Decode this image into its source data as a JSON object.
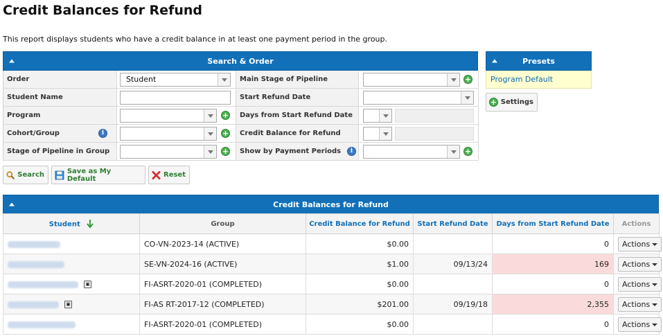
{
  "page": {
    "title": "Credit Balances for Refund",
    "description": "This report displays students who have a credit balance in at least one payment period in the group."
  },
  "search_panel": {
    "title": "Search & Order",
    "fields": {
      "order_label": "Order",
      "order_value": "Student",
      "student_name_label": "Student Name",
      "program_label": "Program",
      "cohort_label": "Cohort/Group",
      "stage_group_label": "Stage of Pipeline in Group",
      "main_stage_label": "Main Stage of Pipeline",
      "start_refund_label": "Start Refund Date",
      "days_from_label": "Days from Start Refund Date",
      "credit_balance_label": "Credit Balance for Refund",
      "show_periods_label": "Show by Payment Periods"
    },
    "buttons": {
      "search": "Search",
      "save_default": "Save as My Default",
      "reset": "Reset"
    }
  },
  "presets_panel": {
    "title": "Presets",
    "item": "Program Default",
    "settings_label": "Settings"
  },
  "results": {
    "title": "Credit Balances for Refund",
    "columns": [
      "Student",
      "Group",
      "Credit Balance for Refund",
      "Start Refund Date",
      "Days from Start Refund Date",
      "Actions"
    ],
    "rows": [
      {
        "group": "CO-VN-2023-14 (ACTIVE)",
        "balance": "$0.00",
        "start": "",
        "days": "0",
        "action": "Actions"
      },
      {
        "group": "SE-VN-2024-16 (ACTIVE)",
        "balance": "$1.00",
        "start": "09/13/24",
        "days": "169",
        "action": "Actions"
      },
      {
        "group": "FI-ASRT-2020-01 (COMPLETED)",
        "balance": "$0.00",
        "start": "",
        "days": "0",
        "action": "Actions"
      },
      {
        "group": "FI-AS RT-2017-12 (COMPLETED)",
        "balance": "$201.00",
        "start": "09/19/18",
        "days": "2,355",
        "action": "Actions"
      },
      {
        "group": "FI-ASRT-2020-01 (COMPLETED)",
        "balance": "$0.00",
        "start": "",
        "days": "0",
        "action": "Actions"
      }
    ]
  },
  "colors": {
    "header_blue": "#1170b8",
    "highlight_pink": "#fadada",
    "preset_yellow": "#ffffd0",
    "button_green": "#2e7d32"
  }
}
